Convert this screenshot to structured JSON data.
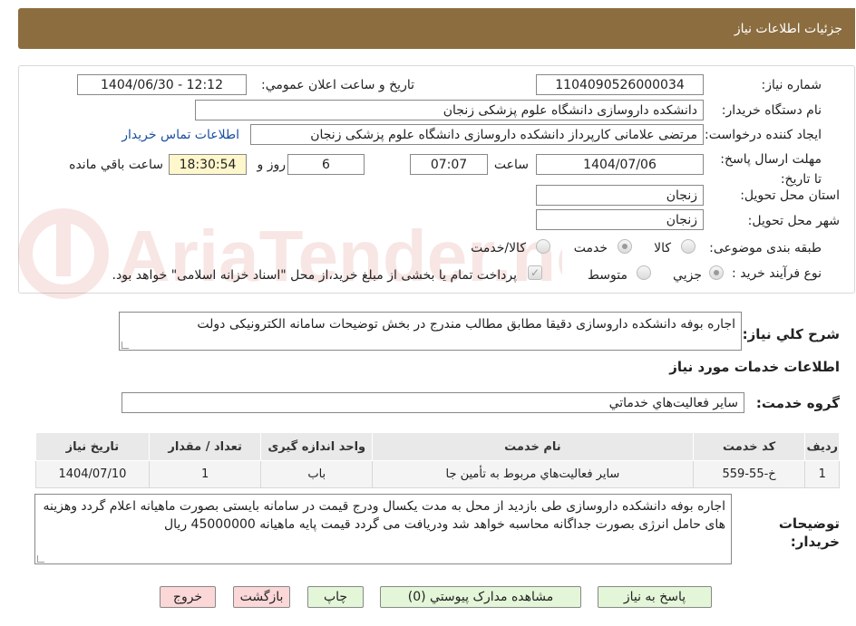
{
  "header": {
    "title": "جزئیات اطلاعات نیاز"
  },
  "form": {
    "need_number_label": "شماره نیاز:",
    "need_number": "1104090526000034",
    "announce_label": "تاریخ و ساعت اعلان عمومي:",
    "announce_value": "1404/06/30 - 12:12",
    "buyer_org_label": "نام دستگاه خريدار:",
    "buyer_org": "دانشکده داروسازی دانشگاه علوم پزشکی زنجان",
    "creator_label": "ايجاد کننده درخواست:",
    "creator": "مرتضی  علامانی کارپرداز دانشکده داروسازی دانشگاه علوم پزشکی زنجان",
    "contact_link": "اطلاعات تماس خريدار",
    "deadline_label": "مهلت ارسال پاسخ: تا تاريخ:",
    "deadline_date": "1404/07/06",
    "time_label": "ساعت",
    "deadline_time": "07:07",
    "days_value": "6",
    "days_label": "روز و",
    "remaining_time": "18:30:54",
    "remaining_label": "ساعت باقي مانده",
    "province_label": "استان محل تحويل:",
    "province": "زنجان",
    "city_label": "شهر محل تحويل:",
    "city": "زنجان",
    "category_label": "طبقه بندی موضوعی:",
    "category_options": [
      "کالا",
      "خدمت",
      "کالا/خدمت"
    ],
    "purchase_type_label": "نوع فرآيند خريد :",
    "purchase_options": [
      "جزيي",
      "متوسط"
    ],
    "payment_note": "پرداخت تمام يا بخشی از مبلغ خريد،از محل \"اسناد خزانه اسلامی\" خواهد بود."
  },
  "summary": {
    "label": "شرح کلي نياز:",
    "text": "اجاره بوفه دانشکده داروسازی دقیقا مطابق مطالب مندرج در بخش توضیحات سامانه الکترونیکی دولت"
  },
  "services": {
    "section_title": "اطلاعات خدمات مورد نياز",
    "group_label": "گروه خدمت:",
    "group_value": "ساير فعاليت‌هاي خدماتي"
  },
  "table": {
    "headers": [
      "رديف",
      "کد خدمت",
      "نام خدمت",
      "واحد اندازه گيری",
      "تعداد / مقدار",
      "تاريخ نياز"
    ],
    "rows": [
      [
        "1",
        "خ-55-559",
        "ساير فعاليت‌هاي مربوط به تأمين جا",
        "باب",
        "1",
        "1404/07/10"
      ]
    ]
  },
  "buyer_notes": {
    "label": "توضيحات خريدار:",
    "text": "اجاره بوفه دانشکده داروسازی طی بازدید از محل به مدت یکسال ودرج قیمت در سامانه بایستی بصورت ماهیانه اعلام گردد وهزینه های حامل انرژی بصورت جداگانه محاسبه خواهد شد ودریافت می گردد قیمت پایه ماهیانه 45000000 ریال"
  },
  "buttons": {
    "reply": "پاسخ به نياز",
    "attachments": "مشاهده مدارک پيوستي (0)",
    "print": "چاپ",
    "back": "بازگشت",
    "exit": "خروج"
  },
  "watermark": {
    "text": "AriaTender.neT"
  },
  "colors": {
    "header_bg": "#8c6d3f",
    "link": "#1a4fa0",
    "time_highlight": "#fff7cc"
  }
}
